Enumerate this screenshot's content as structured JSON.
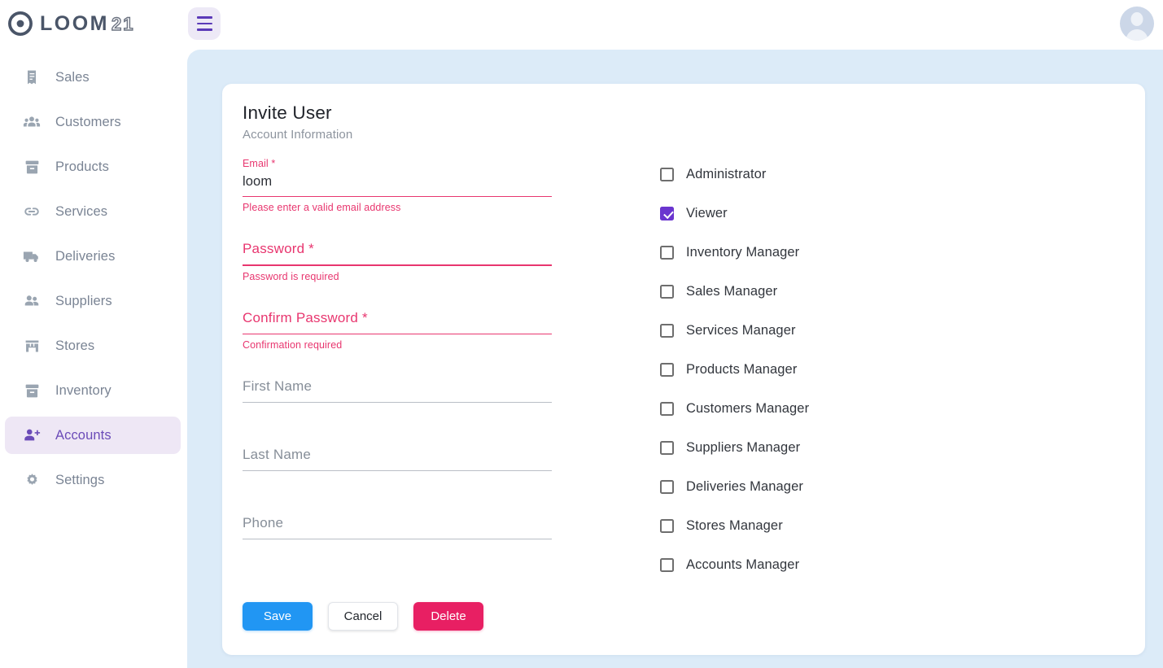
{
  "brand": {
    "solid": "LOOM",
    "outline": "21",
    "logo_icon": "aperture-icon"
  },
  "topbar": {
    "menu_icon": "hamburger-menu-icon",
    "avatar_icon": "user-avatar-icon"
  },
  "sidebar": {
    "items": [
      {
        "label": "Sales",
        "icon": "receipt-icon",
        "active": false
      },
      {
        "label": "Customers",
        "icon": "people-icon",
        "active": false
      },
      {
        "label": "Products",
        "icon": "box-icon",
        "active": false
      },
      {
        "label": "Services",
        "icon": "link-icon",
        "active": false
      },
      {
        "label": "Deliveries",
        "icon": "truck-icon",
        "active": false
      },
      {
        "label": "Suppliers",
        "icon": "people-icon",
        "active": false
      },
      {
        "label": "Stores",
        "icon": "storefront-icon",
        "active": false
      },
      {
        "label": "Inventory",
        "icon": "box-icon",
        "active": false
      },
      {
        "label": "Accounts",
        "icon": "person-add-icon",
        "active": true
      },
      {
        "label": "Settings",
        "icon": "gear-icon",
        "active": false
      }
    ]
  },
  "card": {
    "title": "Invite User",
    "subtitle": "Account Information",
    "fields": [
      {
        "name": "email",
        "label": "Email *",
        "value": "loom",
        "error": "Please enter a valid email address",
        "state": "error-filled"
      },
      {
        "name": "password",
        "label": "Password *",
        "value": "",
        "error": "Password is required",
        "state": "error-empty"
      },
      {
        "name": "confirm_password",
        "label": "Confirm Password *",
        "value": "",
        "error": "Confirmation required",
        "state": "error-empty"
      },
      {
        "name": "first_name",
        "label": "First Name",
        "value": "",
        "error": "",
        "state": "normal"
      },
      {
        "name": "last_name",
        "label": "Last Name",
        "value": "",
        "error": "",
        "state": "normal"
      },
      {
        "name": "phone",
        "label": "Phone",
        "value": "",
        "error": "",
        "state": "normal"
      }
    ],
    "permissions": [
      {
        "label": "Administrator",
        "checked": false
      },
      {
        "label": "Viewer",
        "checked": true
      },
      {
        "label": "Inventory Manager",
        "checked": false
      },
      {
        "label": "Sales Manager",
        "checked": false
      },
      {
        "label": "Services Manager",
        "checked": false
      },
      {
        "label": "Products Manager",
        "checked": false
      },
      {
        "label": "Customers Manager",
        "checked": false
      },
      {
        "label": "Suppliers Manager",
        "checked": false
      },
      {
        "label": "Deliveries Manager",
        "checked": false
      },
      {
        "label": "Stores Manager",
        "checked": false
      },
      {
        "label": "Accounts Manager",
        "checked": false
      }
    ],
    "buttons": {
      "save": "Save",
      "cancel": "Cancel",
      "delete": "Delete"
    }
  },
  "colors": {
    "accent_purple": "#6a35cf",
    "nav_active_bg": "#eee7f5",
    "nav_active_text": "#6b4bb8",
    "error_pink": "#e8366f",
    "save_blue": "#2196f3",
    "delete_pink": "#e81f63",
    "stage_blue": "#dcebf8"
  }
}
